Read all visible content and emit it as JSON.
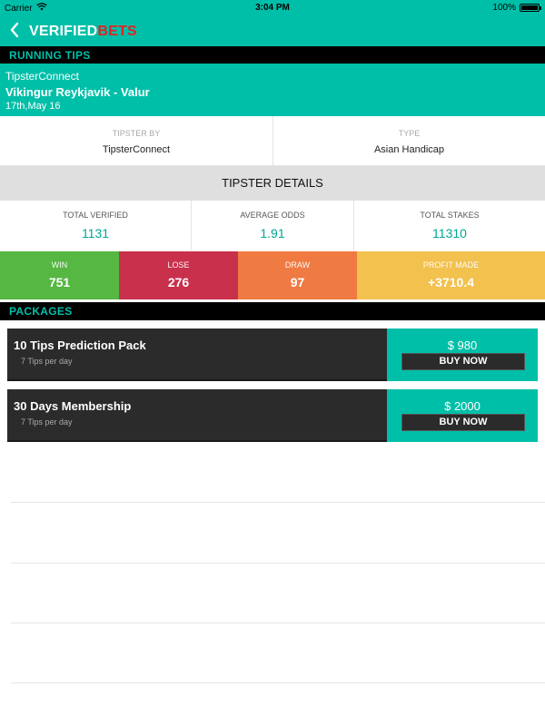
{
  "status_bar": {
    "carrier": "Carrier",
    "time": "3:04 PM",
    "battery": "100%"
  },
  "header": {
    "brand_part1": "VERIFIED",
    "brand_part2": "BETS",
    "brand_color": "#00bfa8",
    "accent_color": "#e02424"
  },
  "running_tips": {
    "title": "RUNNING TIPS",
    "tipster": "TipsterConnect",
    "match": "Vikingur Reykjavik - Valur",
    "date": "17th,May 16"
  },
  "tip_info": {
    "tipster_label": "TIPSTER BY",
    "tipster_value": "TipsterConnect",
    "type_label": "TYPE",
    "type_value": "Asian Handicap"
  },
  "tipster_details": {
    "title": "TIPSTER DETAILS",
    "stats": [
      {
        "label": "TOTAL VERIFIED",
        "value": "1131"
      },
      {
        "label": "AVERAGE ODDS",
        "value": "1.91"
      },
      {
        "label": "TOTAL STAKES",
        "value": "11310"
      }
    ],
    "results": [
      {
        "label": "WIN",
        "value": "751",
        "color": "#56b742"
      },
      {
        "label": "LOSE",
        "value": "276",
        "color": "#c8304c"
      },
      {
        "label": "DRAW",
        "value": "97",
        "color": "#ef7a42"
      },
      {
        "label": "PROFIT MADE",
        "value": "+3710.4",
        "color": "#f2c14e"
      }
    ]
  },
  "packages": {
    "title": "PACKAGES",
    "items": [
      {
        "name": "10 Tips Prediction Pack",
        "subtitle": "7 Tips per day",
        "price": "$ 980",
        "button": "BUY NOW"
      },
      {
        "name": "30 Days Membership",
        "subtitle": "7 Tips per day",
        "price": "$ 2000",
        "button": "BUY NOW"
      }
    ]
  }
}
